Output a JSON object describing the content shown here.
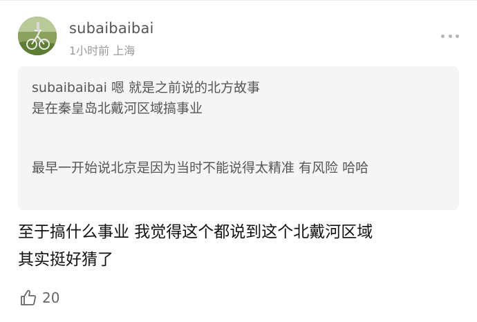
{
  "comment": {
    "username": "subaibaibai",
    "meta": "1小时前 上海",
    "quote": {
      "lines": [
        "subaibaibai 嗯 就是之前说的北方故事",
        "是在秦皇岛北戴河区域搞事业",
        "最早一开始说北京是因为当时不能说得太精准 有风险 哈哈"
      ]
    },
    "body_lines": [
      "至于搞什么事业 我觉得这个都说到这个北戴河区域",
      "其实挺好猜了"
    ],
    "like_count": "20"
  },
  "icons": {
    "more": "more-dots-icon",
    "like": "thumbs-up-icon"
  },
  "colors": {
    "quote_background": "#f5f5f5",
    "meta_text": "#9a9a9a",
    "username_text": "#555555"
  }
}
